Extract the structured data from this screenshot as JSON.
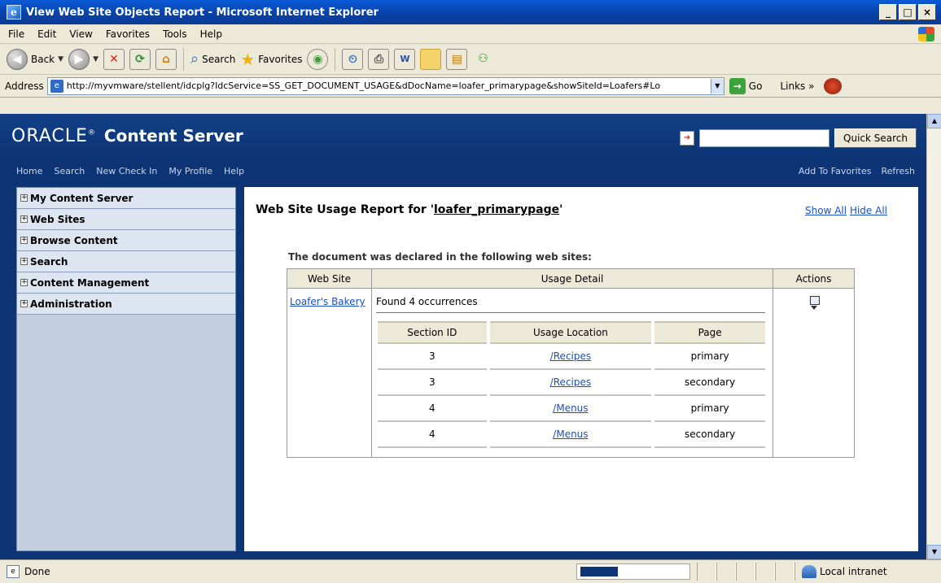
{
  "window": {
    "title": "View Web Site Objects Report - Microsoft Internet Explorer",
    "buttons": {
      "minimize": "_",
      "maximize": "□",
      "close": "×"
    }
  },
  "menubar": {
    "items": [
      "File",
      "Edit",
      "View",
      "Favorites",
      "Tools",
      "Help"
    ]
  },
  "toolbar": {
    "back": "Back",
    "search": "Search",
    "favorites": "Favorites"
  },
  "addressbar": {
    "label": "Address",
    "url": "http://myvmware/stellent/idcplg?IdcService=SS_GET_DOCUMENT_USAGE&dDocName=loafer_primarypage&showSiteId=Loafers#Lo",
    "go": "Go",
    "links": "Links »"
  },
  "oracle": {
    "logo": "ORACLE",
    "product": "Content Server",
    "quick_search_button": "Quick Search",
    "quick_search_value": "",
    "nav": [
      "Home",
      "Search",
      "New Check In",
      "My Profile",
      "Help"
    ],
    "nav_right": [
      "Add To Favorites",
      "Refresh"
    ]
  },
  "sidebar": {
    "items": [
      {
        "label": "My Content Server"
      },
      {
        "label": "Web Sites"
      },
      {
        "label": "Browse Content"
      },
      {
        "label": "Search"
      },
      {
        "label": "Content Management"
      },
      {
        "label": "Administration"
      }
    ]
  },
  "report": {
    "title_prefix": "Web Site Usage Report for '",
    "doc_name": "loafer_primarypage",
    "title_suffix": "'",
    "show_all": "Show All",
    "hide_all": "Hide All",
    "declared_text": "The document was declared in the following web sites:",
    "columns": [
      "Web Site",
      "Usage Detail",
      "Actions"
    ],
    "site": "Loafer's Bakery",
    "found_text": "Found 4 occurrences",
    "detail_columns": [
      "Section ID",
      "Usage Location",
      "Page"
    ],
    "rows": [
      {
        "section_id": "3",
        "location": "/Recipes",
        "page": "primary"
      },
      {
        "section_id": "3",
        "location": "/Recipes",
        "page": "secondary"
      },
      {
        "section_id": "4",
        "location": "/Menus",
        "page": "primary"
      },
      {
        "section_id": "4",
        "location": "/Menus",
        "page": "secondary"
      }
    ]
  },
  "statusbar": {
    "text": "Done",
    "zone": "Local intranet",
    "progress_fraction": 0.35
  }
}
